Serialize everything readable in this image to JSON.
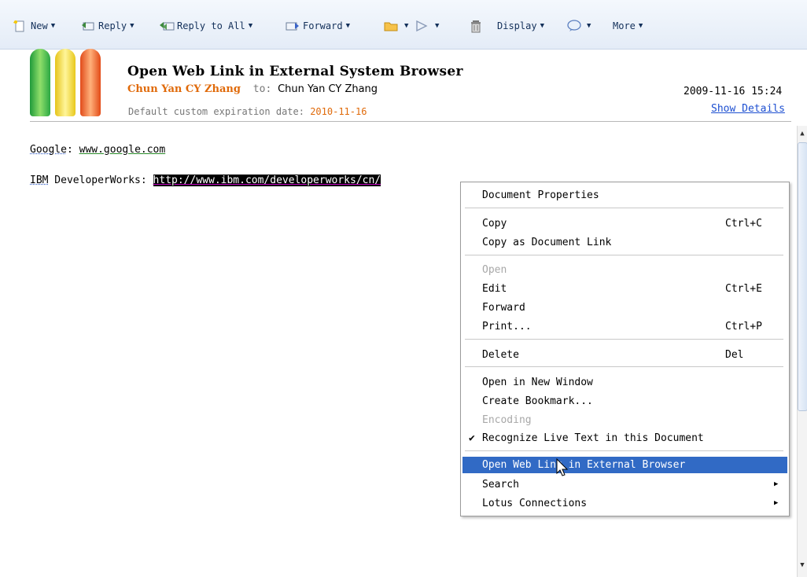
{
  "toolbar": {
    "new": "New",
    "reply": "Reply",
    "reply_all": "Reply to All",
    "forward": "Forward",
    "display": "Display",
    "more": "More"
  },
  "header": {
    "subject": "Open Web Link in External System Browser",
    "from": "Chun Yan CY Zhang",
    "to_label": "to:",
    "to": "Chun Yan CY Zhang",
    "expiration_label": "Default custom expiration date:",
    "expiration_date": "2010-11-16",
    "timestamp": "2009-11-16 15:24",
    "show_details": "Show Details"
  },
  "body": {
    "line1_label": "Google",
    "line1_sep": ": ",
    "line1_link": "www.google.com",
    "line2_label": "IBM",
    "line2_rest": " DeveloperWorks: ",
    "line2_link": "http://www.ibm.com/developerworks/cn/"
  },
  "context_menu": {
    "items": [
      {
        "label": "Document Properties",
        "shortcut": ""
      },
      {
        "label": "Copy",
        "shortcut": "Ctrl+C"
      },
      {
        "label": "Copy as Document Link",
        "shortcut": ""
      },
      {
        "label": "Open",
        "shortcut": "",
        "disabled": true
      },
      {
        "label": "Edit",
        "shortcut": "Ctrl+E"
      },
      {
        "label": "Forward",
        "shortcut": ""
      },
      {
        "label": "Print...",
        "shortcut": "Ctrl+P"
      },
      {
        "label": "Delete",
        "shortcut": "Del"
      },
      {
        "label": "Open in New Window",
        "shortcut": ""
      },
      {
        "label": "Create Bookmark...",
        "shortcut": ""
      },
      {
        "label": "Encoding",
        "shortcut": "",
        "disabled": true
      },
      {
        "label": "Recognize Live Text in this Document",
        "shortcut": "",
        "checked": true
      },
      {
        "label": "Open Web Link in External Browser",
        "shortcut": "",
        "highlighted": true
      },
      {
        "label": "Search",
        "shortcut": "",
        "submenu": true
      },
      {
        "label": "Lotus Connections",
        "shortcut": "",
        "submenu": true
      }
    ]
  },
  "icons": {
    "check": "checkmark-icon",
    "submenu": "submenu-arrow-icon"
  },
  "colors": {
    "accent": "#316ac5",
    "sender": "#e06a0a",
    "link": "#1d4fd1"
  }
}
